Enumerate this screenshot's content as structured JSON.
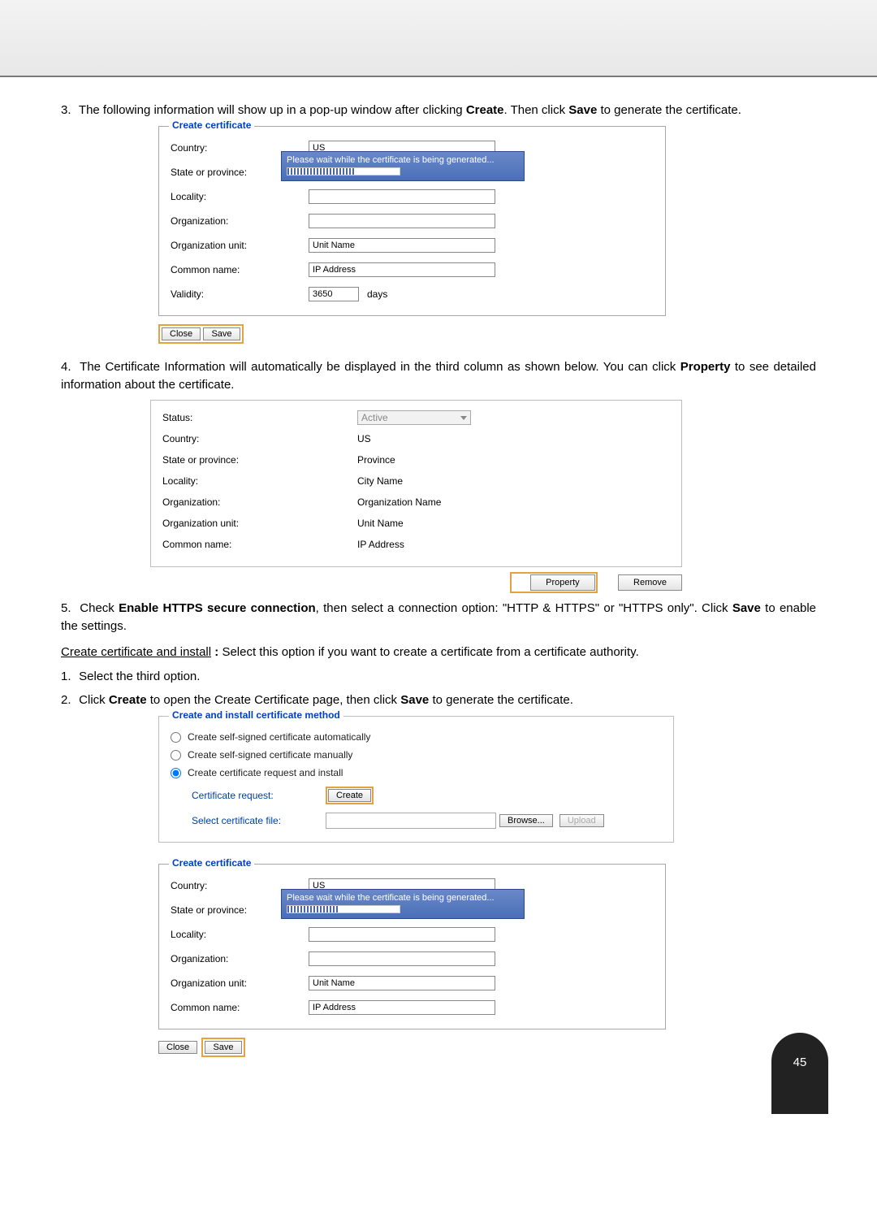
{
  "step3": {
    "num": "3.",
    "text_a": "The following information will show up in a pop-up window after clicking ",
    "bold_a": "Create",
    "text_b": ". Then click ",
    "bold_b": "Save",
    "text_c": " to generate the certificate."
  },
  "cert_dialog": {
    "title": "Create certificate",
    "country_lbl": "Country:",
    "country_val": "US",
    "state_lbl": "State or province:",
    "locality_lbl": "Locality:",
    "org_lbl": "Organization:",
    "orgunit_lbl": "Organization unit:",
    "orgunit_val": "Unit Name",
    "common_lbl": "Common name:",
    "common_val": "IP Address",
    "validity_lbl": "Validity:",
    "validity_val": "3650",
    "validity_unit": "days",
    "progress_msg": "Please wait while the certificate is being generated...",
    "close_btn": "Close",
    "save_btn": "Save"
  },
  "step4": {
    "num": "4.",
    "text_a": "The Certificate Information will automatically be displayed in the third column as shown below. You can click ",
    "bold_a": "Property",
    "text_b": " to see detailed information about the certificate."
  },
  "cert_info": {
    "status_lbl": "Status:",
    "status_val": "Active",
    "country_lbl": "Country:",
    "country_val": "US",
    "state_lbl": "State or province:",
    "state_val": "Province",
    "locality_lbl": "Locality:",
    "locality_val": "City Name",
    "org_lbl": "Organization:",
    "org_val": "Organization Name",
    "orgunit_lbl": "Organization unit:",
    "orgunit_val": "Unit Name",
    "common_lbl": "Common name:",
    "common_val": "IP Address",
    "property_btn": "Property",
    "remove_btn": "Remove"
  },
  "step5": {
    "num": "5.",
    "text_a": "Check ",
    "bold_a": "Enable HTTPS secure connection",
    "text_b": ", then select a connection option: \"HTTP & HTTPS\" or \"HTTPS only\". Click ",
    "bold_b": "Save",
    "text_c": " to enable the settings."
  },
  "create_install": {
    "heading": "Create certificate and install",
    "sep": " : ",
    "text": "Select this option if you want to create a certificate from a certificate authority."
  },
  "step_ci_1": {
    "num": "1.",
    "text": "Select the third option."
  },
  "step_ci_2": {
    "num": "2.",
    "text_a": "Click ",
    "bold_a": "Create",
    "text_b": " to open the Create Certificate page, then click ",
    "bold_b": "Save",
    "text_c": " to generate the certificate."
  },
  "method_box": {
    "title": "Create and install certificate method",
    "opt1": "Create self-signed certificate automatically",
    "opt2": "Create self-signed certificate manually",
    "opt3": "Create certificate request and install",
    "req_lbl": "Certificate request:",
    "create_btn": "Create",
    "file_lbl": "Select certificate file:",
    "browse_btn": "Browse...",
    "upload_btn": "Upload"
  },
  "cert_dialog2": {
    "title": "Create certificate",
    "country_lbl": "Country:",
    "country_val": "US",
    "state_lbl": "State or province:",
    "locality_lbl": "Locality:",
    "org_lbl": "Organization:",
    "orgunit_lbl": "Organization unit:",
    "orgunit_val": "Unit Name",
    "common_lbl": "Common name:",
    "common_val": "IP Address",
    "progress_msg": "Please wait while the certificate is being generated...",
    "close_btn": "Close",
    "save_btn": "Save"
  },
  "page_number": "45"
}
